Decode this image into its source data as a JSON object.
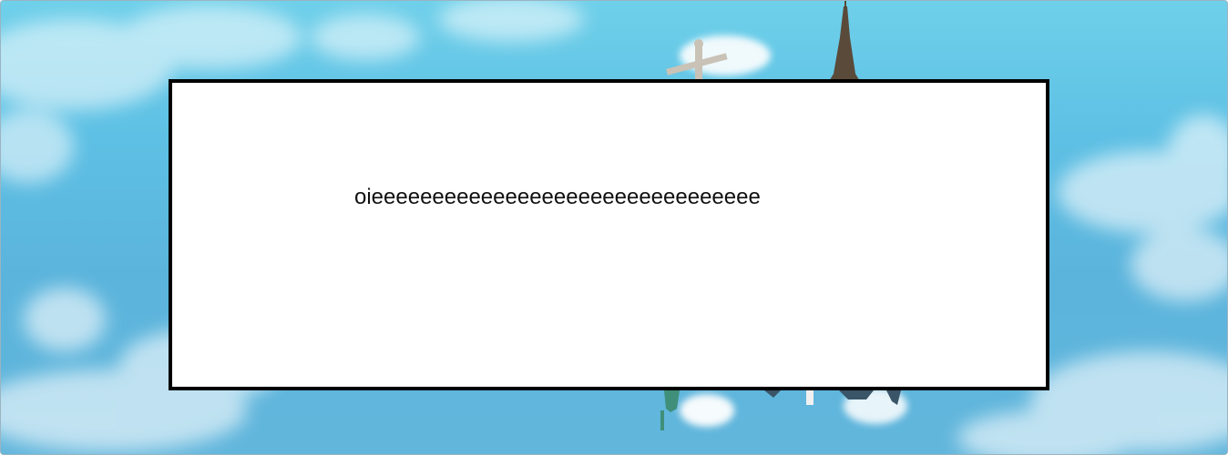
{
  "background": {
    "sky_color": "#5ec0e4",
    "illustration": "landmarks-globe-icon"
  },
  "dialog": {
    "message": "oieeeeeeeeeeeeeeeeeeeeeeeeeeeeeeee",
    "border_color": "#000000",
    "background_color": "#ffffff"
  }
}
